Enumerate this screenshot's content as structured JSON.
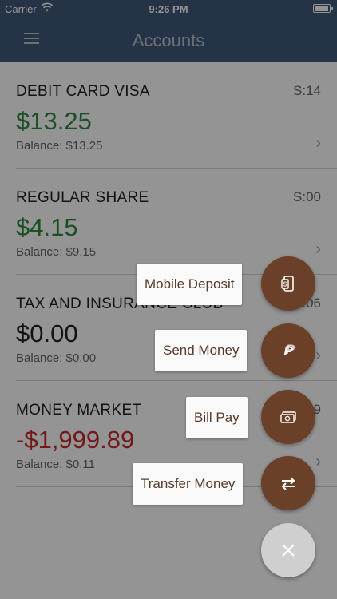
{
  "status_bar": {
    "carrier": "Carrier",
    "time": "9:26 PM"
  },
  "nav": {
    "title": "Accounts"
  },
  "accounts": [
    {
      "name": "DEBIT CARD VISA",
      "code": "S:14",
      "amount": "$13.25",
      "balance": "Balance: $13.25"
    },
    {
      "name": "REGULAR SHARE",
      "code": "S:00",
      "amount": "$4.15",
      "balance": "Balance: $9.15"
    },
    {
      "name": "TAX AND INSURANCE CLUB",
      "code": "S:06",
      "amount": "$0.00",
      "balance": "Balance: $0.00"
    },
    {
      "name": "MONEY MARKET",
      "code": "S:09",
      "amount": "-$1,999.89",
      "balance": "Balance: $0.11"
    }
  ],
  "colors": {
    "header": "#3f5877",
    "positive": "#2e8b3e",
    "negative": "#c62828",
    "fab": "#6b4029"
  },
  "fab_menu": {
    "mobile_deposit": "Mobile Deposit",
    "send_money": "Send Money",
    "bill_pay": "Bill Pay",
    "transfer_money": "Transfer Money",
    "icons": [
      "mobile-check-icon",
      "paypal-icon",
      "cash-icon",
      "transfer-arrows-icon",
      "close-icon"
    ]
  }
}
